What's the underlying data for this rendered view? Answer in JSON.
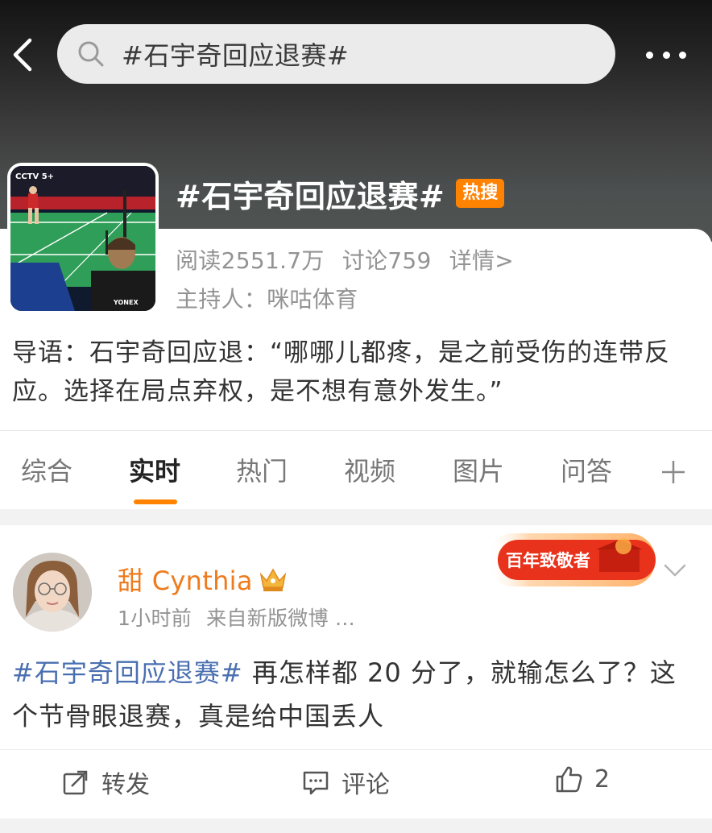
{
  "search": {
    "query": "#石宇奇回应退赛#"
  },
  "topic": {
    "title": "#石宇奇回应退赛#",
    "hot_badge": "热搜",
    "reads": "阅读2551.7万",
    "discussions": "讨论759",
    "details_link": "详情>",
    "host": "主持人：咪咕体育",
    "intro": "导语：石宇奇回应退：“哪哪儿都疼，是之前受伤的连带反应。选择在局点弃权，是不想有意外发生。”",
    "thumb_overlay_text": [
      "CCTV 5+",
      "YONEX"
    ]
  },
  "tabs": [
    {
      "label": "综合",
      "active": false
    },
    {
      "label": "实时",
      "active": true
    },
    {
      "label": "热门",
      "active": false
    },
    {
      "label": "视频",
      "active": false
    },
    {
      "label": "图片",
      "active": false
    },
    {
      "label": "问答",
      "active": false
    }
  ],
  "post": {
    "username": "甜 Cynthia",
    "time": "1小时前",
    "source": "来自新版微博 ...",
    "badge_text": "百年致敬者",
    "topic_tag": "#石宇奇回应退赛#",
    "text": " 再怎样都 20 分了，就输怎么了？这个节骨眼退赛，真是给中国丢人",
    "actions": {
      "repost": "转发",
      "comment": "评论",
      "likes": "2"
    }
  },
  "colors": {
    "accent_orange": "#ff8200",
    "username_orange": "#ee7b1d",
    "topic_link_blue": "#4a6fb0",
    "muted_gray": "#939393"
  },
  "icons": [
    "back-arrow-icon",
    "search-icon",
    "more-dots-icon",
    "plus-icon",
    "crown-icon",
    "chevron-down-icon",
    "share-icon",
    "comment-icon",
    "thumbs-up-icon"
  ]
}
